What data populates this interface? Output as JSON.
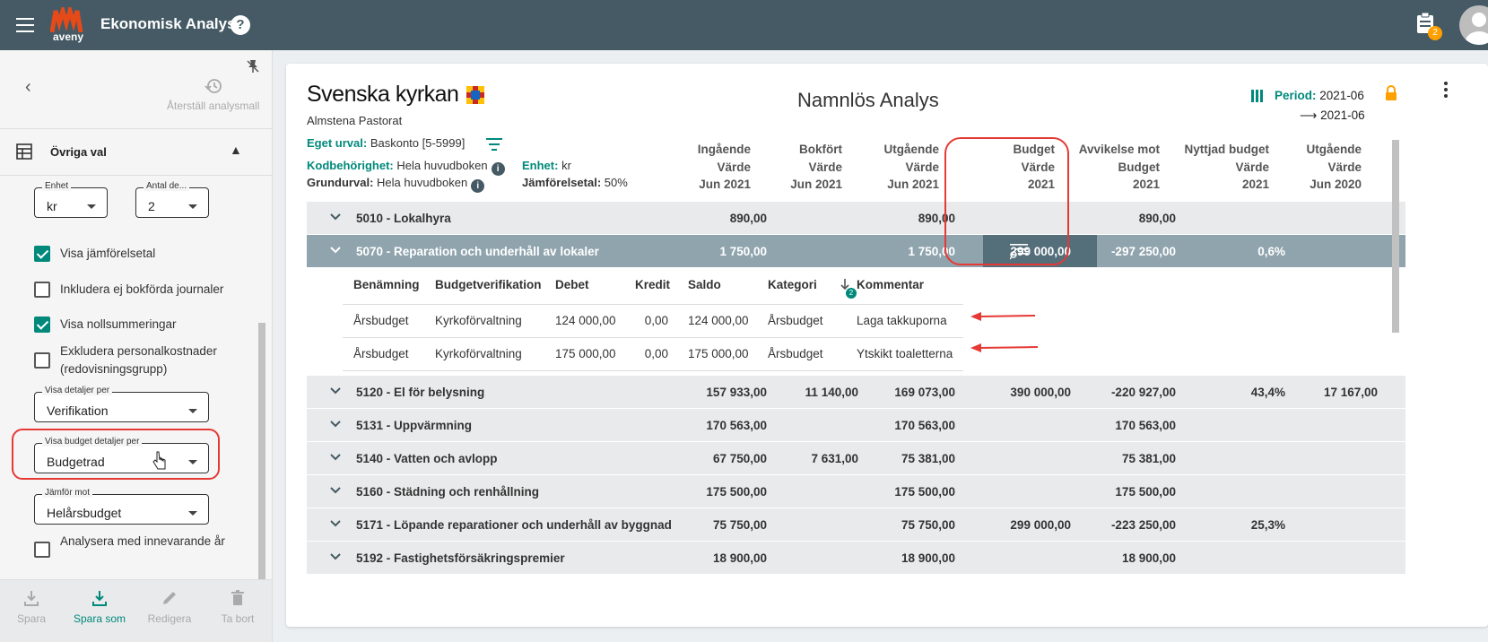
{
  "header": {
    "logo_text": "aveny",
    "app_title": "Ekonomisk Analys",
    "help": "?",
    "notification_count": "2"
  },
  "sidebar": {
    "restore_label": "Återställ analysmall",
    "section_title": "Övriga val",
    "enhet": {
      "label": "Enhet",
      "value": "kr"
    },
    "decimals": {
      "label": "Antal de...",
      "value": "2"
    },
    "checks": [
      {
        "label": "Visa jämförelsetal",
        "checked": true
      },
      {
        "label": "Inkludera ej bokförda journaler",
        "checked": false
      },
      {
        "label": "Visa nollsummeringar",
        "checked": true
      },
      {
        "label": "Exkludera personalkostnader",
        "label2": "(redovisningsgrupp)",
        "checked": false
      }
    ],
    "details_per": {
      "label": "Visa detaljer per",
      "value": "Verifikation"
    },
    "budget_details_per": {
      "label": "Visa budget detaljer per",
      "value": "Budgetrad"
    },
    "compare_with": {
      "label": "Jämför mot",
      "value": "Helårsbudget"
    },
    "last_check": "Analysera med innevarande år",
    "footer": {
      "save": "Spara",
      "save_as": "Spara som",
      "edit": "Redigera",
      "delete": "Ta bort"
    }
  },
  "report": {
    "brand": "Svenska kyrkan",
    "org": "Almstena Pastorat",
    "title": "Namnlös Analys",
    "period_label": "Period:",
    "period_from": "2021-06",
    "period_to": "2021-06",
    "eget_urval_label": "Eget urval:",
    "eget_urval": "Baskonto [5-5999]",
    "kodbehorighet_label": "Kodbehörighet:",
    "kodbehorighet": "Hela huvudboken",
    "grundurval_label": "Grundurval:",
    "grundurval": "Hela huvudboken",
    "enhet_label": "Enhet:",
    "enhet": "kr",
    "jamforelse_label": "Jämförelsetal:",
    "jamforelse": "50%",
    "columns": [
      {
        "l1": "Ingående",
        "l2": "Värde",
        "l3": "Jun 2021"
      },
      {
        "l1": "Bokfört",
        "l2": "Värde",
        "l3": "Jun 2021"
      },
      {
        "l1": "Utgående",
        "l2": "Värde",
        "l3": "Jun 2021"
      },
      {
        "l1": "Budget",
        "l2": "Värde",
        "l3": "2021"
      },
      {
        "l1": "Avvikelse mot",
        "l2": "Budget",
        "l3": "2021"
      },
      {
        "l1": "Nyttjad budget",
        "l2": "Värde",
        "l3": "2021"
      },
      {
        "l1": "Utgående",
        "l2": "Värde",
        "l3": "Jun 2020"
      }
    ],
    "rows": [
      {
        "name": "5010 - Lokalhyra",
        "v": [
          "890,00",
          "",
          "890,00",
          "",
          "890,00",
          "",
          ""
        ]
      },
      {
        "name": "5070 - Reparation och underhåll av lokaler",
        "v": [
          "1 750,00",
          "",
          "1 750,00",
          "299 000,00",
          "-297 250,00",
          "0,6%",
          ""
        ]
      },
      {
        "name": "5120 - El för belysning",
        "v": [
          "157 933,00",
          "11 140,00",
          "169 073,00",
          "390 000,00",
          "-220 927,00",
          "43,4%",
          "17 167,00"
        ]
      },
      {
        "name": "5131 - Uppvärmning",
        "v": [
          "170 563,00",
          "",
          "170 563,00",
          "",
          "170 563,00",
          "",
          ""
        ]
      },
      {
        "name": "5140 - Vatten och avlopp",
        "v": [
          "67 750,00",
          "7 631,00",
          "75 381,00",
          "",
          "75 381,00",
          "",
          ""
        ]
      },
      {
        "name": "5160 - Städning och renhållning",
        "v": [
          "175 500,00",
          "",
          "175 500,00",
          "",
          "175 500,00",
          "",
          ""
        ]
      },
      {
        "name": "5171 - Löpande reparationer och underhåll av byggnad",
        "v": [
          "75 750,00",
          "",
          "75 750,00",
          "299 000,00",
          "-223 250,00",
          "25,3%",
          ""
        ]
      },
      {
        "name": "5192 - Fastighetsförsäkringspremier",
        "v": [
          "18 900,00",
          "",
          "18 900,00",
          "",
          "18 900,00",
          "",
          ""
        ]
      }
    ],
    "detail": {
      "headers": [
        "Benämning",
        "Budgetverifikation",
        "Debet",
        "Kredit",
        "Saldo",
        "Kategori",
        "Kommentar"
      ],
      "sort_badge": "2",
      "rows": [
        [
          "Årsbudget",
          "Kyrkoförvaltning",
          "124 000,00",
          "0,00",
          "124 000,00",
          "Årsbudget",
          "Laga takkuporna"
        ],
        [
          "Årsbudget",
          "Kyrkoförvaltning",
          "175 000,00",
          "0,00",
          "175 000,00",
          "Årsbudget",
          "Ytskikt toaletterna"
        ]
      ]
    }
  }
}
